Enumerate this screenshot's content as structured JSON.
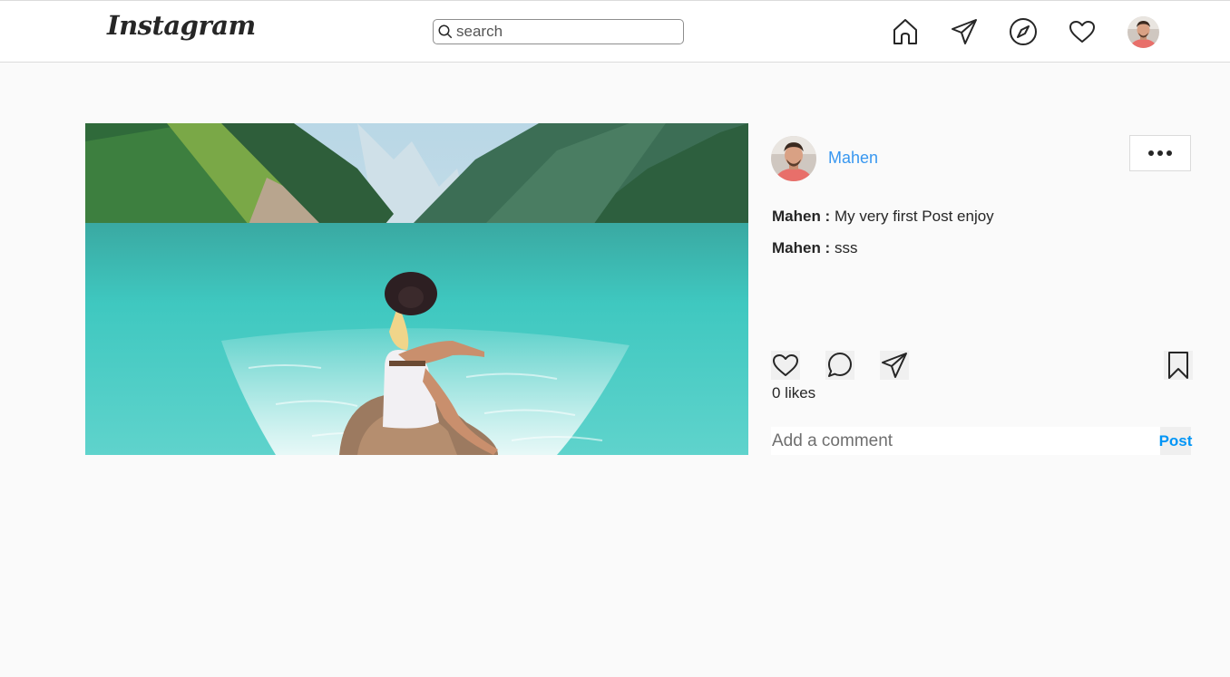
{
  "header": {
    "logo": "Instagram",
    "search_placeholder": "search"
  },
  "icons": {
    "search": "search-icon",
    "home": "home-icon",
    "direct": "paper-plane-icon",
    "explore": "compass-icon",
    "activity": "heart-icon",
    "like": "heart-icon",
    "comment": "comment-bubble-icon",
    "share": "paper-plane-icon",
    "save": "bookmark-icon",
    "more": "more-dots-icon"
  },
  "post": {
    "author": "Mahen",
    "comments": [
      {
        "user": "Mahen :",
        "text": "My very first Post enjoy"
      },
      {
        "user": "Mahen :",
        "text": "sss"
      }
    ],
    "likes": "0 likes",
    "comment_placeholder": "Add a comment",
    "post_label": "Post"
  },
  "colors": {
    "link_blue": "#3897f0",
    "post_blue": "#0095f6",
    "page_bg": "#fafafa",
    "water": "#3cc4bd"
  }
}
